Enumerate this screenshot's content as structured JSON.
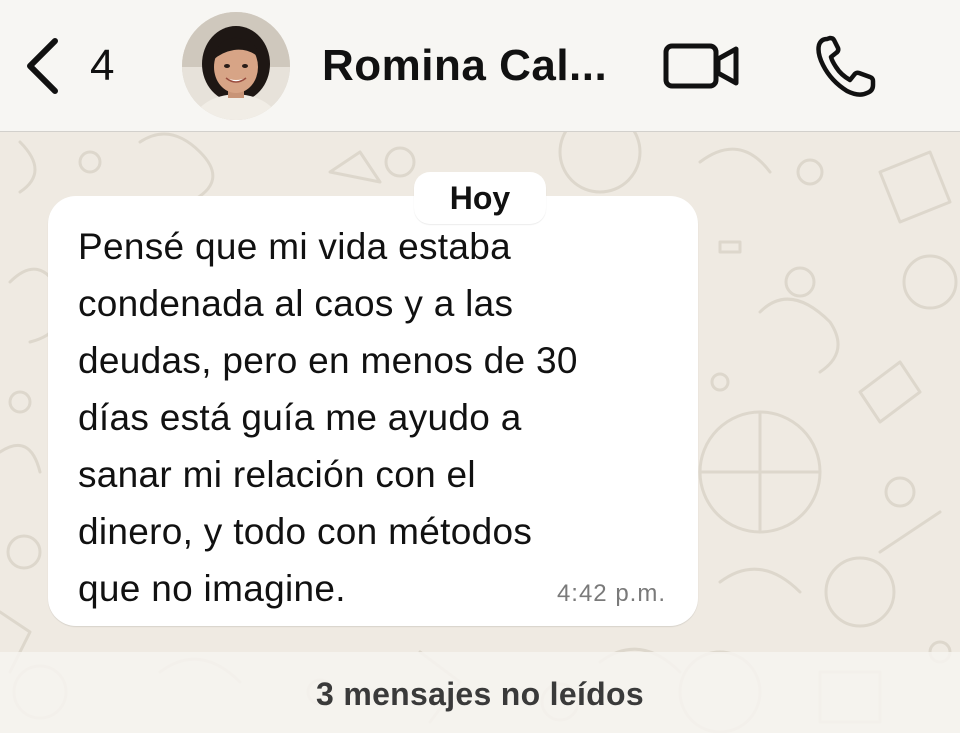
{
  "header": {
    "back_count": "4",
    "contact_name": "Romina  Cal..."
  },
  "icons": {
    "back": "chevron-left-icon",
    "video": "video-camera-icon",
    "call": "phone-icon"
  },
  "chat": {
    "date_label": "Hoy",
    "messages": [
      {
        "text": "Pensé que mi vida estaba\ncondenada al caos y a las\ndeudas, pero en menos de 30\ndías está guía me ayudo a\nsanar mi relación con el\ndinero, y todo con métodos\nque no imagine.",
        "time": "4:42 p.m.",
        "direction": "incoming"
      }
    ],
    "unread_label": "3 mensajes no leídos"
  },
  "colors": {
    "header_bg": "#f7f6f3",
    "chat_bg": "#efeae2",
    "bubble_bg": "#ffffff",
    "text": "#111111",
    "time_text": "#7a7a7a"
  }
}
